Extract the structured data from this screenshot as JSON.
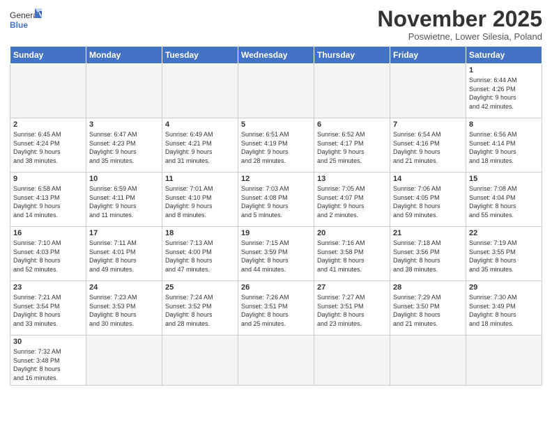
{
  "logo": {
    "text_general": "General",
    "text_blue": "Blue"
  },
  "title": "November 2025",
  "subtitle": "Poswietne, Lower Silesia, Poland",
  "weekdays": [
    "Sunday",
    "Monday",
    "Tuesday",
    "Wednesday",
    "Thursday",
    "Friday",
    "Saturday"
  ],
  "weeks": [
    [
      {
        "day": "",
        "info": ""
      },
      {
        "day": "",
        "info": ""
      },
      {
        "day": "",
        "info": ""
      },
      {
        "day": "",
        "info": ""
      },
      {
        "day": "",
        "info": ""
      },
      {
        "day": "",
        "info": ""
      },
      {
        "day": "1",
        "info": "Sunrise: 6:44 AM\nSunset: 4:26 PM\nDaylight: 9 hours\nand 42 minutes."
      }
    ],
    [
      {
        "day": "2",
        "info": "Sunrise: 6:45 AM\nSunset: 4:24 PM\nDaylight: 9 hours\nand 38 minutes."
      },
      {
        "day": "3",
        "info": "Sunrise: 6:47 AM\nSunset: 4:23 PM\nDaylight: 9 hours\nand 35 minutes."
      },
      {
        "day": "4",
        "info": "Sunrise: 6:49 AM\nSunset: 4:21 PM\nDaylight: 9 hours\nand 31 minutes."
      },
      {
        "day": "5",
        "info": "Sunrise: 6:51 AM\nSunset: 4:19 PM\nDaylight: 9 hours\nand 28 minutes."
      },
      {
        "day": "6",
        "info": "Sunrise: 6:52 AM\nSunset: 4:17 PM\nDaylight: 9 hours\nand 25 minutes."
      },
      {
        "day": "7",
        "info": "Sunrise: 6:54 AM\nSunset: 4:16 PM\nDaylight: 9 hours\nand 21 minutes."
      },
      {
        "day": "8",
        "info": "Sunrise: 6:56 AM\nSunset: 4:14 PM\nDaylight: 9 hours\nand 18 minutes."
      }
    ],
    [
      {
        "day": "9",
        "info": "Sunrise: 6:58 AM\nSunset: 4:13 PM\nDaylight: 9 hours\nand 14 minutes."
      },
      {
        "day": "10",
        "info": "Sunrise: 6:59 AM\nSunset: 4:11 PM\nDaylight: 9 hours\nand 11 minutes."
      },
      {
        "day": "11",
        "info": "Sunrise: 7:01 AM\nSunset: 4:10 PM\nDaylight: 9 hours\nand 8 minutes."
      },
      {
        "day": "12",
        "info": "Sunrise: 7:03 AM\nSunset: 4:08 PM\nDaylight: 9 hours\nand 5 minutes."
      },
      {
        "day": "13",
        "info": "Sunrise: 7:05 AM\nSunset: 4:07 PM\nDaylight: 9 hours\nand 2 minutes."
      },
      {
        "day": "14",
        "info": "Sunrise: 7:06 AM\nSunset: 4:05 PM\nDaylight: 8 hours\nand 59 minutes."
      },
      {
        "day": "15",
        "info": "Sunrise: 7:08 AM\nSunset: 4:04 PM\nDaylight: 8 hours\nand 55 minutes."
      }
    ],
    [
      {
        "day": "16",
        "info": "Sunrise: 7:10 AM\nSunset: 4:03 PM\nDaylight: 8 hours\nand 52 minutes."
      },
      {
        "day": "17",
        "info": "Sunrise: 7:11 AM\nSunset: 4:01 PM\nDaylight: 8 hours\nand 49 minutes."
      },
      {
        "day": "18",
        "info": "Sunrise: 7:13 AM\nSunset: 4:00 PM\nDaylight: 8 hours\nand 47 minutes."
      },
      {
        "day": "19",
        "info": "Sunrise: 7:15 AM\nSunset: 3:59 PM\nDaylight: 8 hours\nand 44 minutes."
      },
      {
        "day": "20",
        "info": "Sunrise: 7:16 AM\nSunset: 3:58 PM\nDaylight: 8 hours\nand 41 minutes."
      },
      {
        "day": "21",
        "info": "Sunrise: 7:18 AM\nSunset: 3:56 PM\nDaylight: 8 hours\nand 38 minutes."
      },
      {
        "day": "22",
        "info": "Sunrise: 7:19 AM\nSunset: 3:55 PM\nDaylight: 8 hours\nand 35 minutes."
      }
    ],
    [
      {
        "day": "23",
        "info": "Sunrise: 7:21 AM\nSunset: 3:54 PM\nDaylight: 8 hours\nand 33 minutes."
      },
      {
        "day": "24",
        "info": "Sunrise: 7:23 AM\nSunset: 3:53 PM\nDaylight: 8 hours\nand 30 minutes."
      },
      {
        "day": "25",
        "info": "Sunrise: 7:24 AM\nSunset: 3:52 PM\nDaylight: 8 hours\nand 28 minutes."
      },
      {
        "day": "26",
        "info": "Sunrise: 7:26 AM\nSunset: 3:51 PM\nDaylight: 8 hours\nand 25 minutes."
      },
      {
        "day": "27",
        "info": "Sunrise: 7:27 AM\nSunset: 3:51 PM\nDaylight: 8 hours\nand 23 minutes."
      },
      {
        "day": "28",
        "info": "Sunrise: 7:29 AM\nSunset: 3:50 PM\nDaylight: 8 hours\nand 21 minutes."
      },
      {
        "day": "29",
        "info": "Sunrise: 7:30 AM\nSunset: 3:49 PM\nDaylight: 8 hours\nand 18 minutes."
      }
    ],
    [
      {
        "day": "30",
        "info": "Sunrise: 7:32 AM\nSunset: 3:48 PM\nDaylight: 8 hours\nand 16 minutes."
      },
      {
        "day": "",
        "info": ""
      },
      {
        "day": "",
        "info": ""
      },
      {
        "day": "",
        "info": ""
      },
      {
        "day": "",
        "info": ""
      },
      {
        "day": "",
        "info": ""
      },
      {
        "day": "",
        "info": ""
      }
    ]
  ]
}
